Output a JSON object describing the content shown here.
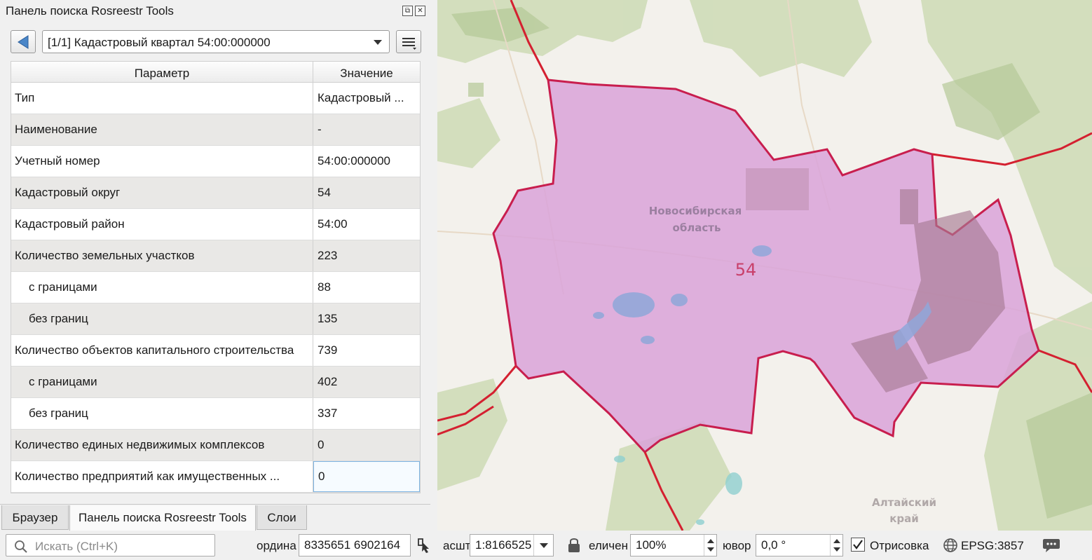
{
  "dock": {
    "title": "Панель поиска Rosreestr Tools",
    "combo_value": "[1/1] Кадастровый квартал 54:00:000000"
  },
  "table": {
    "headers": [
      "Параметр",
      "Значение"
    ],
    "rows": [
      {
        "param": "Тип",
        "value": "Кадастровый ..."
      },
      {
        "param": "Наименование",
        "value": "-"
      },
      {
        "param": "Учетный номер",
        "value": "54:00:000000"
      },
      {
        "param": "Кадастровый округ",
        "value": "54"
      },
      {
        "param": "Кадастровый район",
        "value": "54:00"
      },
      {
        "param": "Количество земельных участков",
        "value": "223"
      },
      {
        "param": "с границами",
        "value": "88"
      },
      {
        "param": "без границ",
        "value": "135"
      },
      {
        "param": "Количество объектов капитального строительства",
        "value": "739"
      },
      {
        "param": "с границами",
        "value": "402"
      },
      {
        "param": "без границ",
        "value": "337"
      },
      {
        "param": "Количество единых недвижимых комплексов",
        "value": "0"
      },
      {
        "param": "Количество предприятий как имущественных ...",
        "value": "0"
      }
    ]
  },
  "tabs": [
    "Браузер",
    "Панель поиска Rosreestr Tools",
    "Слои"
  ],
  "map": {
    "region_label": "Новосибирская",
    "region_label2": "область",
    "region_number": "54",
    "neighbor_label": "Алтайский",
    "neighbor_label2": "край",
    "fill_color": "#d9a3d9",
    "border_color": "#c81e4e"
  },
  "status": {
    "search_placeholder": "Искать (Ctrl+K)",
    "coord_label": "ордина",
    "coord_value": "8335651  6902164",
    "scale_label": "асшт",
    "scale_value": "1:8166525",
    "magnifier_label": "еличен",
    "magnifier_value": "100%",
    "rotation_label": "ювор",
    "rotation_value": "0,0 °",
    "render_label": "Отрисовка",
    "crs_label": "EPSG:3857"
  }
}
